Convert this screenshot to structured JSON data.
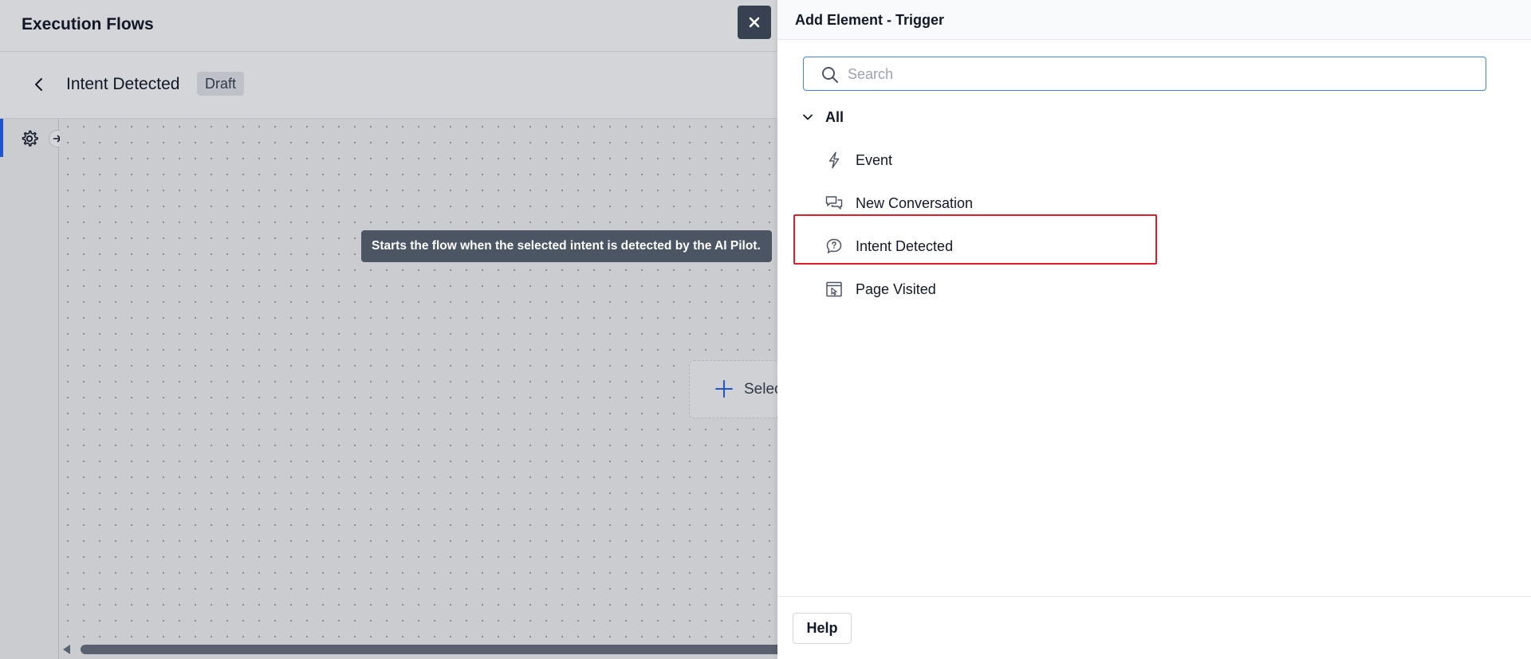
{
  "app": {
    "title": "Execution Flows",
    "flow_name": "Intent Detected",
    "status_badge": "Draft"
  },
  "canvas": {
    "tooltip": "Starts the flow when the selected intent is detected by the AI Pilot.",
    "select_card_label": "Selec"
  },
  "drawer": {
    "title": "Add Element - Trigger",
    "search": {
      "placeholder": "Search",
      "value": ""
    },
    "group": {
      "label": "All",
      "expanded": true
    },
    "items": [
      {
        "label": "Event",
        "icon": "lightning-icon"
      },
      {
        "label": "New Conversation",
        "icon": "chat-bubbles-icon"
      },
      {
        "label": "Intent Detected",
        "icon": "question-bubble-icon",
        "highlighted": true
      },
      {
        "label": "Page Visited",
        "icon": "page-cursor-icon"
      }
    ],
    "help_label": "Help"
  },
  "colors": {
    "accent": "#2563eb",
    "highlight": "#e11d28",
    "tooltip_bg": "#4b5563",
    "close_button_bg": "#374151"
  }
}
